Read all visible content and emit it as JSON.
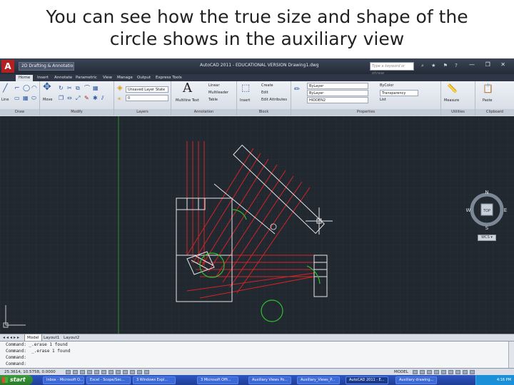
{
  "slide": {
    "title_line1": "You can see how the true size and shape of the",
    "title_line2": "circle shows in the auxiliary view"
  },
  "titlebar": {
    "logo": "A",
    "workspace": "2D Drafting & Annotation",
    "title": "AutoCAD 2011 - EDUCATIONAL VERSION    Drawing1.dwg",
    "search_placeholder": "Type a keyword or phrase",
    "window_buttons": "— ❐ ✕"
  },
  "tabs": [
    "Home",
    "Insert",
    "Annotate",
    "Parametric",
    "View",
    "Manage",
    "Output",
    "Express Tools"
  ],
  "active_tab": "Home",
  "ribbon": {
    "panels": {
      "draw": "Draw",
      "modify": "Modify",
      "layers": "Layers",
      "annotation": "Annotation",
      "block": "Block",
      "properties": "Properties",
      "utilities": "Utilities",
      "clipboard": "Clipboard"
    },
    "draw_items": [
      "Line",
      "Polyline",
      "Circle",
      "Arc"
    ],
    "modify_item": "Move",
    "layer_state": "Unsaved Layer State",
    "layer_current": "0",
    "multiline_text": "Multiline Text",
    "annotation_items": [
      "Linear",
      "Multileader",
      "Table"
    ],
    "insert": "Insert",
    "block_items": [
      "Create",
      "Edit",
      "Edit Attributes"
    ],
    "properties": {
      "color": "ByLayer",
      "linetype": "ByLayer",
      "lineweight": "HIDDEN2",
      "color2": "ByColor",
      "transparency": "Transparency",
      "list": "List"
    },
    "measure": "Measure",
    "paste": "Paste"
  },
  "navcube": {
    "north": "N",
    "south": "S",
    "east": "E",
    "west": "W",
    "face": "TOP",
    "wcs": "WCS ▾"
  },
  "layout_tabs": [
    "Model",
    "Layout1",
    "Layout2"
  ],
  "active_layout": "Model",
  "command_lines": [
    "Command: _.erase 1 found",
    "Command:  _.erase 1 found",
    "Command:",
    "Command:"
  ],
  "status": {
    "coords": "25.3614, 10.5758, 0.0000",
    "model": "MODEL"
  },
  "taskbar": {
    "start": "start",
    "buttons": [
      "Inbox - Microsoft O...",
      "Excel - Scope/Sec...",
      "3 Windows Expl...",
      "3 Microsoft Offi...",
      "Auxiliary Views Po...",
      "Auxiliary_Views_P...",
      "AutoCAD 2011 - E...",
      "Auxiliary drawing..."
    ],
    "active_index": 6,
    "clock": "4:16 PM"
  },
  "colors": {
    "drawing_bg": "#212830",
    "grid": "#2c343e",
    "red": "#d42424",
    "green": "#2fbf2f",
    "white": "#e8e8e8"
  }
}
